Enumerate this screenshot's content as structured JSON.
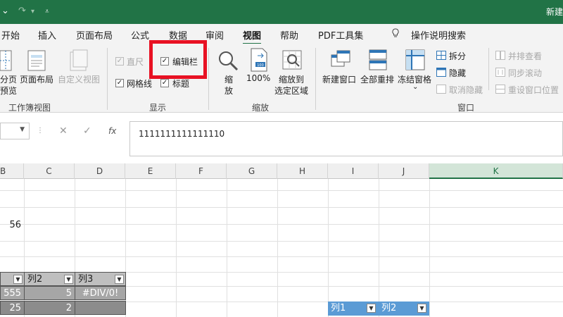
{
  "titlebar": {
    "undo_icon": "undo-arrow-icon",
    "redo_icon": "redo-arrow-icon",
    "customize_icon": "customize-quick-access-icon",
    "doc_title": "新建"
  },
  "tabs": [
    "开始",
    "插入",
    "页面布局",
    "公式",
    "数据",
    "审阅",
    "视图",
    "帮助",
    "PDF工具集"
  ],
  "active_tab": "视图",
  "tell_me": {
    "icon": "lightbulb-icon",
    "label": "操作说明搜索"
  },
  "ribbon": {
    "workbook_views": {
      "page_break_l1": "分页",
      "page_break_l2": "预览",
      "page_layout": "页面布局",
      "custom_views": "自定义视图",
      "group_label": "工作簿视图"
    },
    "show": {
      "ruler": "直尺",
      "formula_bar": "编辑栏",
      "gridlines": "网格线",
      "headings": "标题",
      "group_label": "显示"
    },
    "zoom": {
      "zoom_l1": "缩",
      "zoom_l2": "放",
      "hundred": "100%",
      "zoom_sel_l1": "缩放到",
      "zoom_sel_l2": "选定区域",
      "group_label": "缩放"
    },
    "window": {
      "new_window": "新建窗口",
      "arrange_all": "全部重排",
      "freeze_panes": "冻结窗格",
      "split": "拆分",
      "hide": "隐藏",
      "unhide": "取消隐藏",
      "side_by_side": "并排查看",
      "sync_scroll": "同步滚动",
      "reset_position": "重设窗口位置",
      "group_label": "窗口"
    }
  },
  "formula_bar": {
    "fx": "fx",
    "cancel": "✕",
    "enter": "✓",
    "value": "1111111111111110"
  },
  "columns": [
    "B",
    "C",
    "D",
    "E",
    "F",
    "G",
    "H",
    "I",
    "J",
    "K"
  ],
  "cells": {
    "b56": "56",
    "col2": "列2",
    "col3": "列3",
    "v555": "555",
    "v5": "5",
    "div0": "#DIV/0!",
    "v25": "25",
    "v2": "2",
    "t2col1": "列1",
    "t2col2": "列2"
  }
}
